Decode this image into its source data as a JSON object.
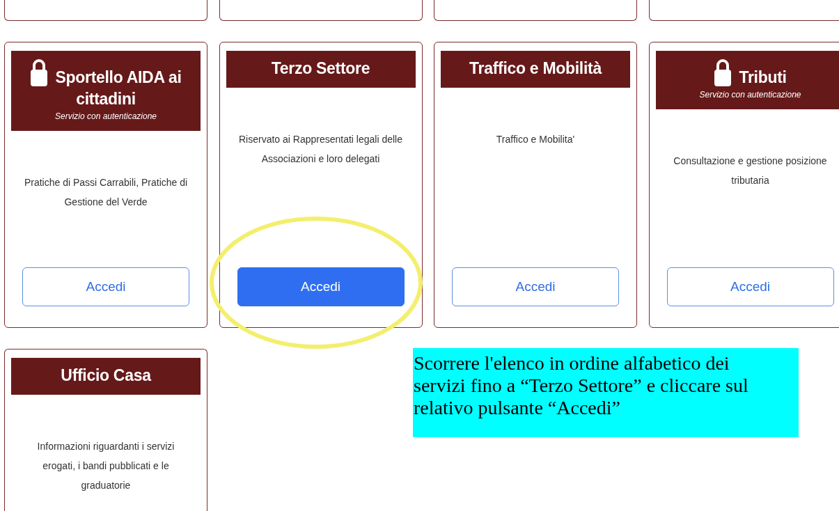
{
  "services": [
    {
      "title": "Sportello AIDA ai cittadini",
      "locked": true,
      "subtitle": "Servizio con autenticazione",
      "description": "Pratiche di Passi Carrabili, Pratiche di Gestione del Verde",
      "button": {
        "label": "Accedi",
        "kind": "outline"
      },
      "circled": false
    },
    {
      "title": "Terzo Settore",
      "locked": false,
      "description": "Riservato ai Rappresentati legali delle Associazioni e loro delegati",
      "button": {
        "label": "Accedi",
        "kind": "primary"
      },
      "circled": true
    },
    {
      "title": "Traffico e Mobilità",
      "locked": false,
      "description": "Traffico e Mobilita'",
      "button": {
        "label": "Accedi",
        "kind": "outline"
      },
      "circled": false
    },
    {
      "title": "Tributi",
      "locked": true,
      "subtitle": "Servizio con autenticazione",
      "description": "Consultazione e gestione posizione tributaria",
      "button": {
        "label": "Accedi",
        "kind": "outline"
      },
      "circled": false
    },
    {
      "title": "Ufficio Casa",
      "locked": false,
      "description": "Informazioni riguardanti i servizi erogati, i bandi pubblicati e le graduatorie",
      "circled": false
    }
  ],
  "note": "Scorrere l'elenco in ordine alfabetico dei servizi fino a “Terzo Settore” e cliccare sul relativo pulsante “Accedi”"
}
